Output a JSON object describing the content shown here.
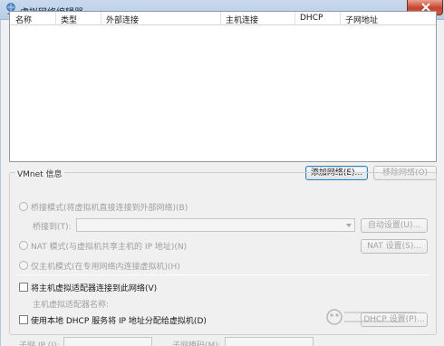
{
  "window": {
    "title": "虚拟网络编辑器",
    "close_icon": "close-icon",
    "app_icon": "globe-person-icon"
  },
  "network_list": {
    "columns": [
      "名称",
      "类型",
      "外部连接",
      "主机连接",
      "DHCP",
      "子网地址"
    ],
    "rows": []
  },
  "buttons": {
    "add_network": "添加网络(E)...",
    "remove_network": "移除网络(O)",
    "auto_settings": "自动设置(U)...",
    "nat_settings": "NAT 设置(S)...",
    "dhcp_settings": "DHCP 设置(P)..."
  },
  "vmnet_info": {
    "group_title": "VMnet 信息",
    "bridged_mode": "桥接模式(将虚拟机直接连接到外部网络)(B)",
    "bridged_to_label": "桥接到(T):",
    "bridged_to_value": "",
    "nat_mode": "NAT 模式(与虚拟机共享主机的 IP 地址)(N)",
    "host_only_mode": "仅主机模式(在专用网络内连接虚拟机)(H)",
    "connect_host_adapter": "将主机虚拟适配器连接到此网络(V)",
    "host_adapter_name_label": "主机虚拟适配器名称:",
    "use_dhcp": "使用本地 DHCP 服务将 IP 地址分配给虚拟机(D)",
    "subnet_ip_label": "子网 IP (I):",
    "subnet_mask_label": "子网掩码(M):"
  }
}
